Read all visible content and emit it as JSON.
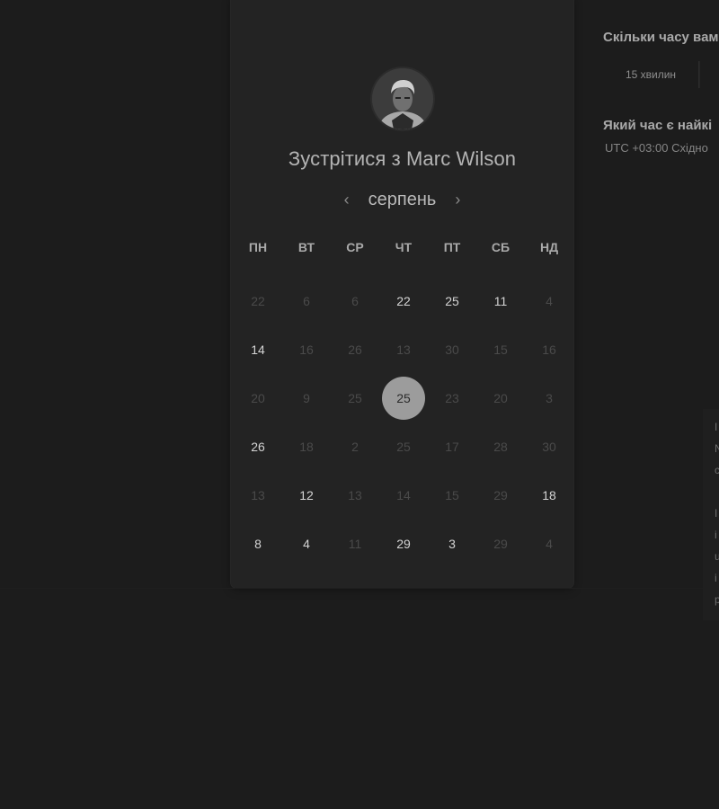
{
  "meeting": {
    "title": "Зустрітися з Marc Wilson"
  },
  "calendar": {
    "month": "серпень",
    "prev_icon": "chevron-left-icon",
    "next_icon": "chevron-right-icon",
    "weekdays": [
      "ПН",
      "ВТ",
      "СР",
      "ЧТ",
      "ПТ",
      "СБ",
      "НД"
    ],
    "weeks": [
      [
        {
          "label": "22",
          "available": false
        },
        {
          "label": "6",
          "available": false
        },
        {
          "label": "6",
          "available": false
        },
        {
          "label": "22",
          "available": true
        },
        {
          "label": "25",
          "available": true
        },
        {
          "label": "11",
          "available": true
        },
        {
          "label": "4",
          "available": false
        }
      ],
      [
        {
          "label": "14",
          "available": true
        },
        {
          "label": "16",
          "available": false
        },
        {
          "label": "26",
          "available": false
        },
        {
          "label": "13",
          "available": false
        },
        {
          "label": "30",
          "available": false
        },
        {
          "label": "15",
          "available": false
        },
        {
          "label": "16",
          "available": false
        }
      ],
      [
        {
          "label": "20",
          "available": false
        },
        {
          "label": "9",
          "available": false
        },
        {
          "label": "25",
          "available": false
        },
        {
          "label": "25",
          "available": true,
          "selected": true
        },
        {
          "label": "23",
          "available": false
        },
        {
          "label": "20",
          "available": false
        },
        {
          "label": "3",
          "available": false
        }
      ],
      [
        {
          "label": "26",
          "available": true
        },
        {
          "label": "18",
          "available": false
        },
        {
          "label": "2",
          "available": false
        },
        {
          "label": "25",
          "available": false
        },
        {
          "label": "17",
          "available": false
        },
        {
          "label": "28",
          "available": false
        },
        {
          "label": "30",
          "available": false
        }
      ],
      [
        {
          "label": "13",
          "available": false
        },
        {
          "label": "12",
          "available": true
        },
        {
          "label": "13",
          "available": false
        },
        {
          "label": "14",
          "available": false
        },
        {
          "label": "15",
          "available": false
        },
        {
          "label": "29",
          "available": false
        },
        {
          "label": "18",
          "available": true
        }
      ],
      [
        {
          "label": "8",
          "available": true
        },
        {
          "label": "4",
          "available": true
        },
        {
          "label": "11",
          "available": false
        },
        {
          "label": "29",
          "available": true
        },
        {
          "label": "3",
          "available": true
        },
        {
          "label": "29",
          "available": false
        },
        {
          "label": "4",
          "available": false
        }
      ]
    ]
  },
  "right_panel": {
    "duration_question": "Скільки часу вам",
    "duration_option": "15 хвилин",
    "time_question": "Який час є найкі",
    "timezone": "UTC +03:00 Східно",
    "side_letters": [
      "I",
      "N",
      "c",
      "I",
      "i",
      "u",
      "i",
      "p"
    ]
  },
  "colors": {
    "background": "#1c1c1c",
    "card": "#232323",
    "selected_day": "#9c9c9c"
  }
}
